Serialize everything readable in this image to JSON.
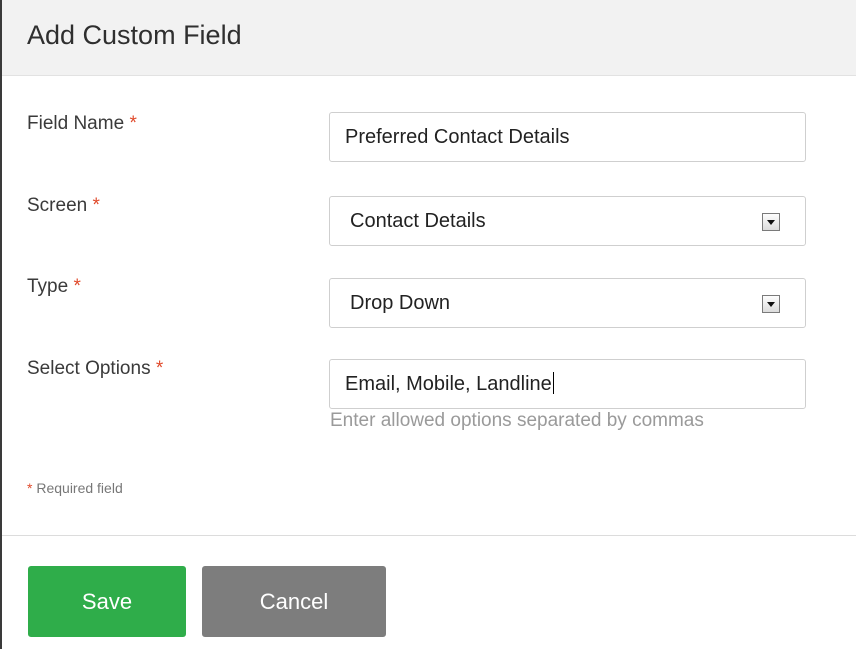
{
  "header": {
    "title": "Add Custom Field"
  },
  "form": {
    "required_marker": "*",
    "field_name": {
      "label": "Field Name",
      "value": "Preferred Contact Details"
    },
    "screen": {
      "label": "Screen",
      "selected": "Contact Details"
    },
    "type": {
      "label": "Type",
      "selected": "Drop Down"
    },
    "select_options": {
      "label": "Select Options",
      "value": "Email, Mobile, Landline",
      "hint": "Enter allowed options separated by commas"
    },
    "required_note": {
      "marker": "*",
      "text": "Required field"
    }
  },
  "actions": {
    "save_label": "Save",
    "cancel_label": "Cancel"
  },
  "colors": {
    "save": "#2fad4a",
    "cancel": "#7d7d7d",
    "required": "#e04a2b",
    "header_bg": "#f2f2f2"
  },
  "icons": {
    "select_arrow": "chevron-down-icon"
  }
}
